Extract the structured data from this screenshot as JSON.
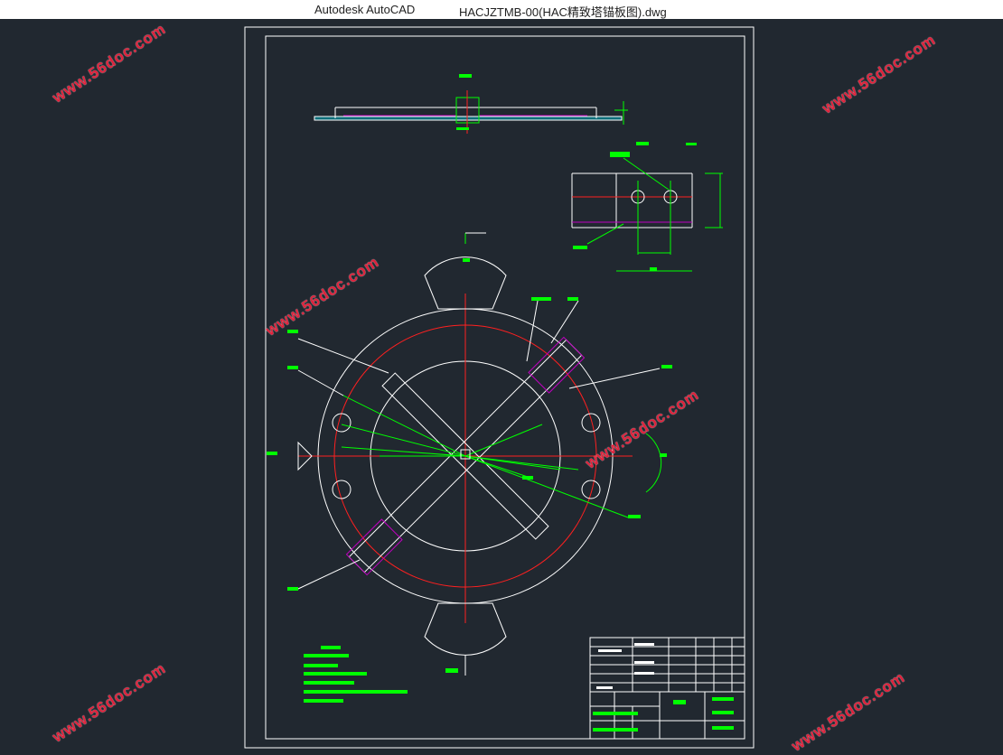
{
  "window": {
    "app_title": "Autodesk AutoCAD",
    "file_title": "HACJZTMB-00(HAC精致塔锚板图).dwg"
  },
  "watermark": {
    "text": "www.56doc.com",
    "color": "#e0203a"
  },
  "drawing": {
    "line_color": "#ffffff",
    "center_line_color": "#ff2020",
    "dimension_color": "#00ff00",
    "hidden_line_color": "#c000c0",
    "background": "#212830"
  }
}
